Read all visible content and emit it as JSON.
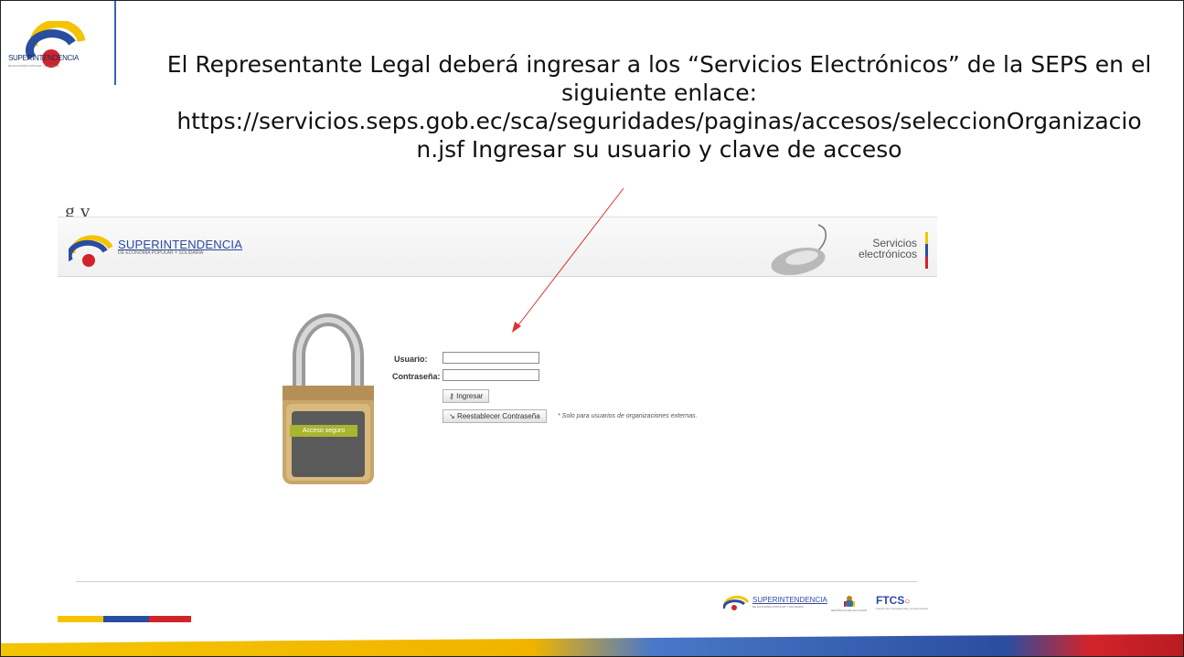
{
  "slide": {
    "logo_text": "SUPERINTENDENCIA",
    "logo_subtext": "DE ECONOMÍA POPULAR Y SOLIDARIA",
    "title_line1": "El Representante Legal deberá ingresar a los “Servicios Electrónicos” de la SEPS en el",
    "title_line2": "siguiente enlace:",
    "title_line3": "https://servicios.seps.gob.ec/sca/seguridades/paginas/accesos/seleccionOrganizacio",
    "title_line4": "n.jsf Ingresar su usuario y clave de acceso",
    "fragment_text": "g                  y",
    "colors": {
      "arrow": "#e03030",
      "accent_blue": "#2a4da0",
      "accent_yellow": "#f5c400",
      "accent_red": "#d1242a"
    }
  },
  "screenshot": {
    "brand": "SUPERINTENDENCIA",
    "brand_sub": "DE ECONOMÍA POPULAR Y SOLIDARIA",
    "services_line1": "Servicios",
    "services_line2": "electrónicos",
    "lock_badge": "Acceso seguro",
    "login": {
      "user_label": "Usuario:",
      "user_value": "",
      "password_label": "Contraseña:",
      "password_value": "",
      "login_button": "Ingresar",
      "reset_button": "Reestablecer Contraseña",
      "note": "* Solo para usuarios de organizaciones externas."
    },
    "footer": {
      "brand": "SUPERINTENDENCIA",
      "brand_sub": "DE ECONOMÍA POPULAR Y SOLIDARIA",
      "gov_sub": "REPÚBLICA DEL ECUADOR",
      "ftcs": "FTCS",
      "ftcs_sub": "Función de Transparencia y Control Social"
    }
  }
}
